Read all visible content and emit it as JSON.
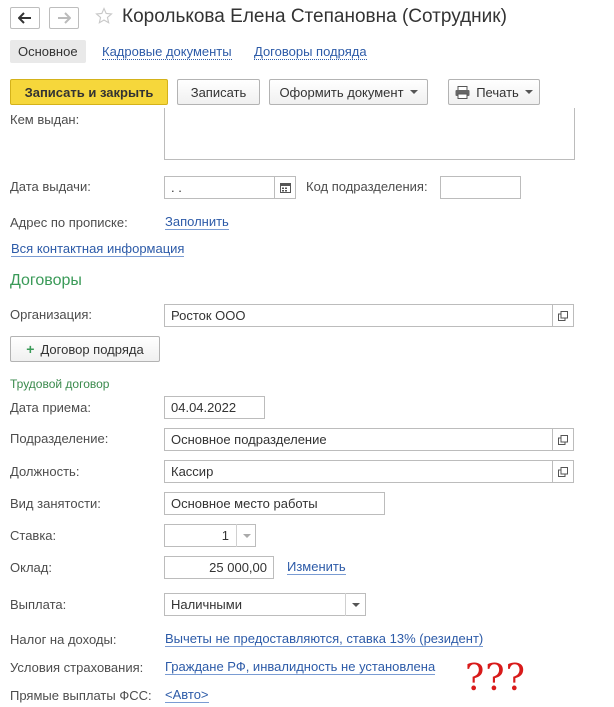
{
  "header": {
    "title": "Королькова Елена Степановна (Сотрудник)",
    "back_icon": "arrow-left-icon",
    "forward_icon": "arrow-right-icon",
    "favorite_icon": "star-icon"
  },
  "tabs": [
    {
      "label": "Основное",
      "active": true
    },
    {
      "label": "Кадровые документы",
      "active": false
    },
    {
      "label": "Договоры подряда",
      "active": false
    }
  ],
  "toolbar": {
    "save_close": "Записать и закрыть",
    "save": "Записать",
    "create_doc": "Оформить документ",
    "print": "Печать"
  },
  "passport": {
    "issued_by_label": "Кем выдан:",
    "issue_date_label": "Дата выдачи:",
    "issue_date_value": " .  .",
    "dept_code_label": "Код подразделения:",
    "address_label": "Адрес по прописке:",
    "address_link": "Заполнить",
    "contacts_link": "Вся контактная информация"
  },
  "contracts": {
    "section_title": "Договоры",
    "org_label": "Организация:",
    "org_value": "Росток ООО",
    "add_contract_button": "Договор подряда"
  },
  "employment": {
    "subsection_title": "Трудовой договор",
    "hire_date_label": "Дата приема:",
    "hire_date_value": "04.04.2022",
    "dept_label": "Подразделение:",
    "dept_value": "Основное подразделение",
    "position_label": "Должность:",
    "position_value": "Кассир",
    "employment_type_label": "Вид занятости:",
    "employment_type_value": "Основное место работы",
    "rate_label": "Ставка:",
    "rate_value": "1",
    "salary_label": "Оклад:",
    "salary_value": "25 000,00",
    "salary_change_link": "Изменить",
    "payment_label": "Выплата:",
    "payment_value": "Наличными",
    "tax_label": "Налог на доходы:",
    "tax_link": "Вычеты не предоставляются, ставка 13% (резидент)",
    "insurance_label": "Условия страхования:",
    "insurance_link": "Граждане РФ, инвалидность не установлена",
    "fss_label": "Прямые выплаты ФСС:",
    "fss_link": "<Авто>"
  },
  "annotation": "???",
  "colors": {
    "accent_yellow": "#f6d73b",
    "link_blue": "#2d5ba8",
    "section_green": "#3a9a58",
    "annotation_red": "#d81a1a"
  }
}
